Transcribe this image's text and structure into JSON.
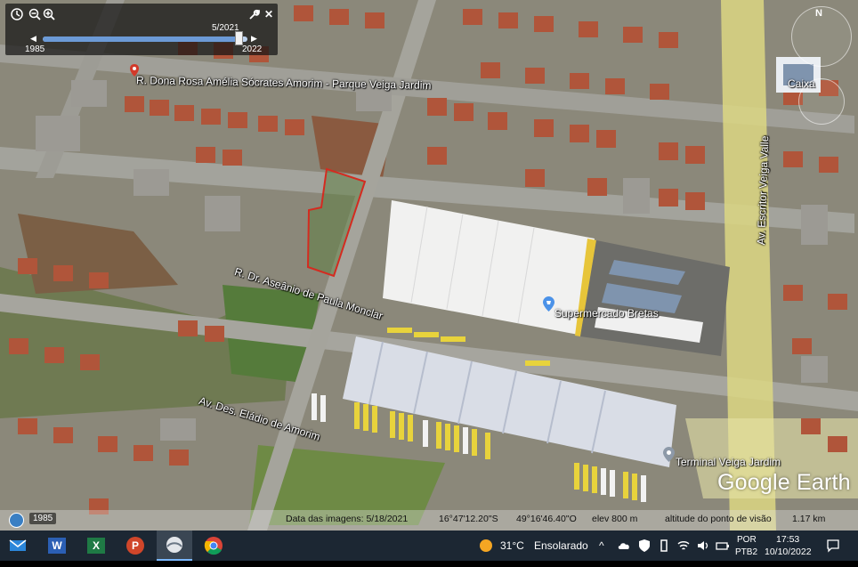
{
  "map": {
    "street_labels": [
      "R. Dona Rosa Amélia Sócrates Amorim - Parque Veiga Jardim",
      "R. Dr. Aseânio de Paula Monclar",
      "Av. Des. Eládio de Amorim",
      "Av. Escritor Veiga Valle"
    ],
    "places": [
      {
        "name": "Supermercado Bretas",
        "icon": "place-pin-icon"
      },
      {
        "name": "Terminal Veiga Jardim",
        "icon": "place-pin-icon"
      },
      {
        "name": "Caixa",
        "icon": "place-pin-icon"
      }
    ],
    "highlight_color": "#d42b20",
    "road_highlight_color": "#e9e39a"
  },
  "time_slider": {
    "current": "5/2021",
    "start": "1985",
    "end": "2022",
    "position": 0.96,
    "tools": [
      "clock-icon",
      "zoom-out-icon",
      "zoom-in-icon",
      "wrench-icon",
      "close-icon"
    ],
    "close_label": "✕"
  },
  "navigation": {
    "north_label": "N"
  },
  "logo": "Google Earth",
  "status_bar": {
    "year_badge": "1985",
    "imagery_date": "Data das imagens: 5/18/2021",
    "latitude": "16°47'12.20\"S",
    "longitude": "49°16'46.40\"O",
    "elevation": "elev  800 m",
    "eye_altitude_label": "altitude do ponto de visão",
    "eye_altitude": "1.17 km"
  },
  "taskbar": {
    "apps": [
      {
        "name": "mail-app",
        "icon": "mail-icon"
      },
      {
        "name": "word-app",
        "icon": "word-icon",
        "glyph": "W"
      },
      {
        "name": "excel-app",
        "icon": "excel-icon",
        "glyph": "X"
      },
      {
        "name": "powerpoint-app",
        "icon": "powerpoint-icon",
        "glyph": "P"
      },
      {
        "name": "google-earth-app",
        "icon": "google-earth-icon"
      },
      {
        "name": "chrome-app",
        "icon": "chrome-icon"
      }
    ],
    "weather": {
      "temp": "31°C",
      "condition": "Ensolarado"
    },
    "language": "POR",
    "keyboard": "PTB2",
    "time": "17:53",
    "date": "10/10/2022"
  }
}
